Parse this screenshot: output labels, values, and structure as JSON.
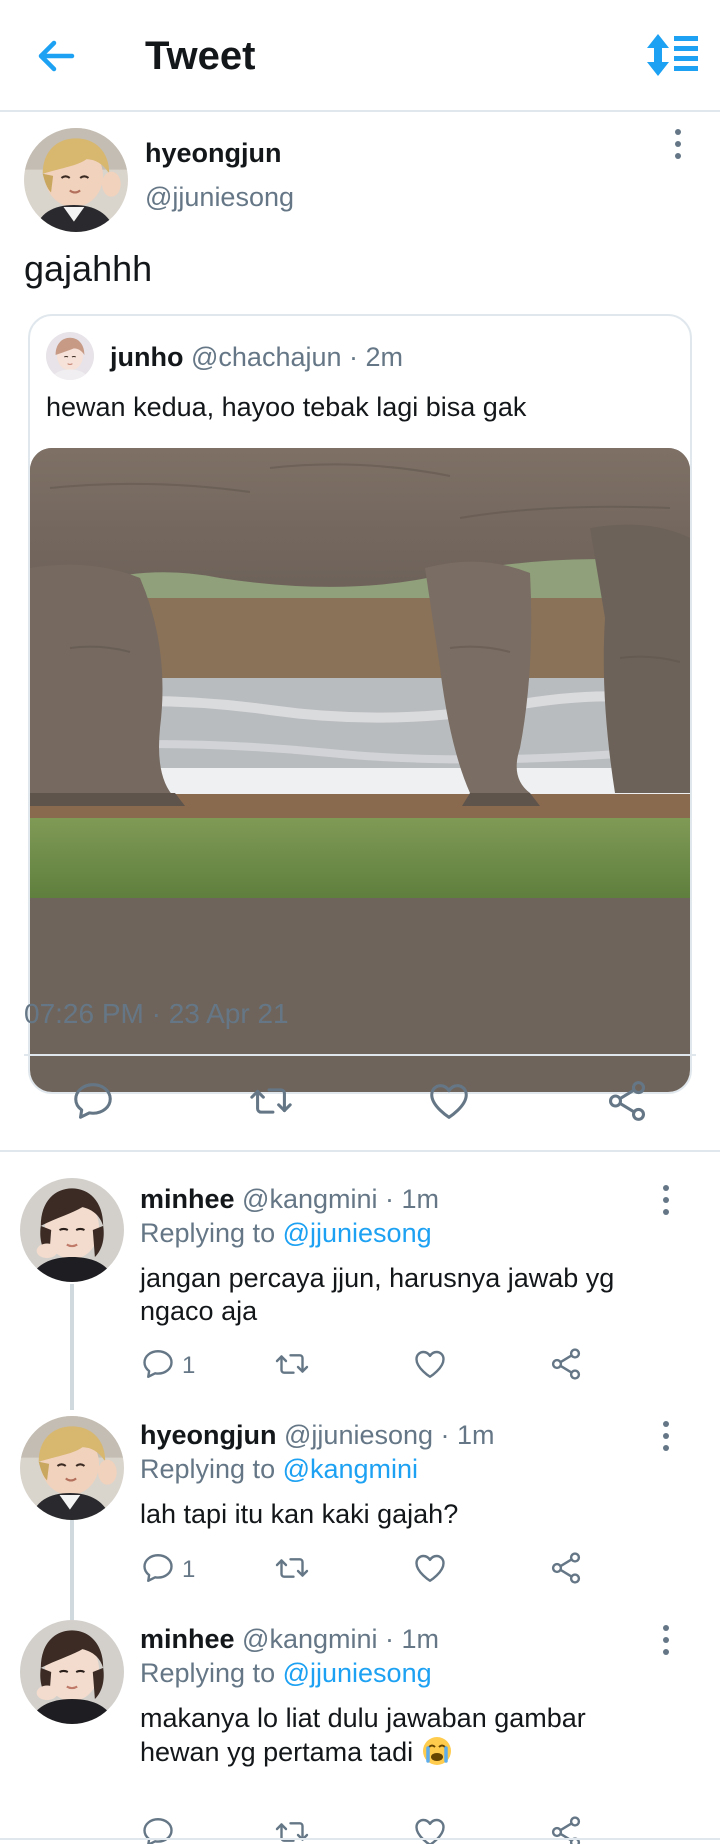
{
  "header": {
    "title": "Tweet"
  },
  "main_tweet": {
    "name": "hyeongjun",
    "handle": "@jjuniesong",
    "text": "gajahhh",
    "quote": {
      "name": "junho",
      "meta": "@chachajun · 2m",
      "text": "hewan kedua, hayoo tebak lagi bisa gak"
    },
    "timestamp": "07:26 PM · 23 Apr 21"
  },
  "replies": [
    {
      "name": "minhee",
      "meta": "@kangmini · 1m",
      "replying_prefix": "Replying to ",
      "replying_to": "@jjuniesong",
      "text": "jangan percaya jjun, harusnya jawab yg ngaco aja",
      "reply_count": "1"
    },
    {
      "name": "hyeongjun",
      "meta": "@jjuniesong · 1m",
      "replying_prefix": "Replying to ",
      "replying_to": "@kangmini",
      "text": "lah tapi itu kan kaki gajah?",
      "reply_count": "1"
    },
    {
      "name": "minhee",
      "meta": "@kangmini · 1m",
      "replying_prefix": "Replying to ",
      "replying_to": "@jjuniesong",
      "text": "makanya lo liat dulu jawaban gambar hewan yg pertama tadi",
      "emoji": "loudly-crying-face",
      "reply_count": ""
    }
  ],
  "colors": {
    "accent": "#1da1f2",
    "text": "#14171a",
    "muted": "#657786",
    "divider": "#e1e8ed"
  }
}
